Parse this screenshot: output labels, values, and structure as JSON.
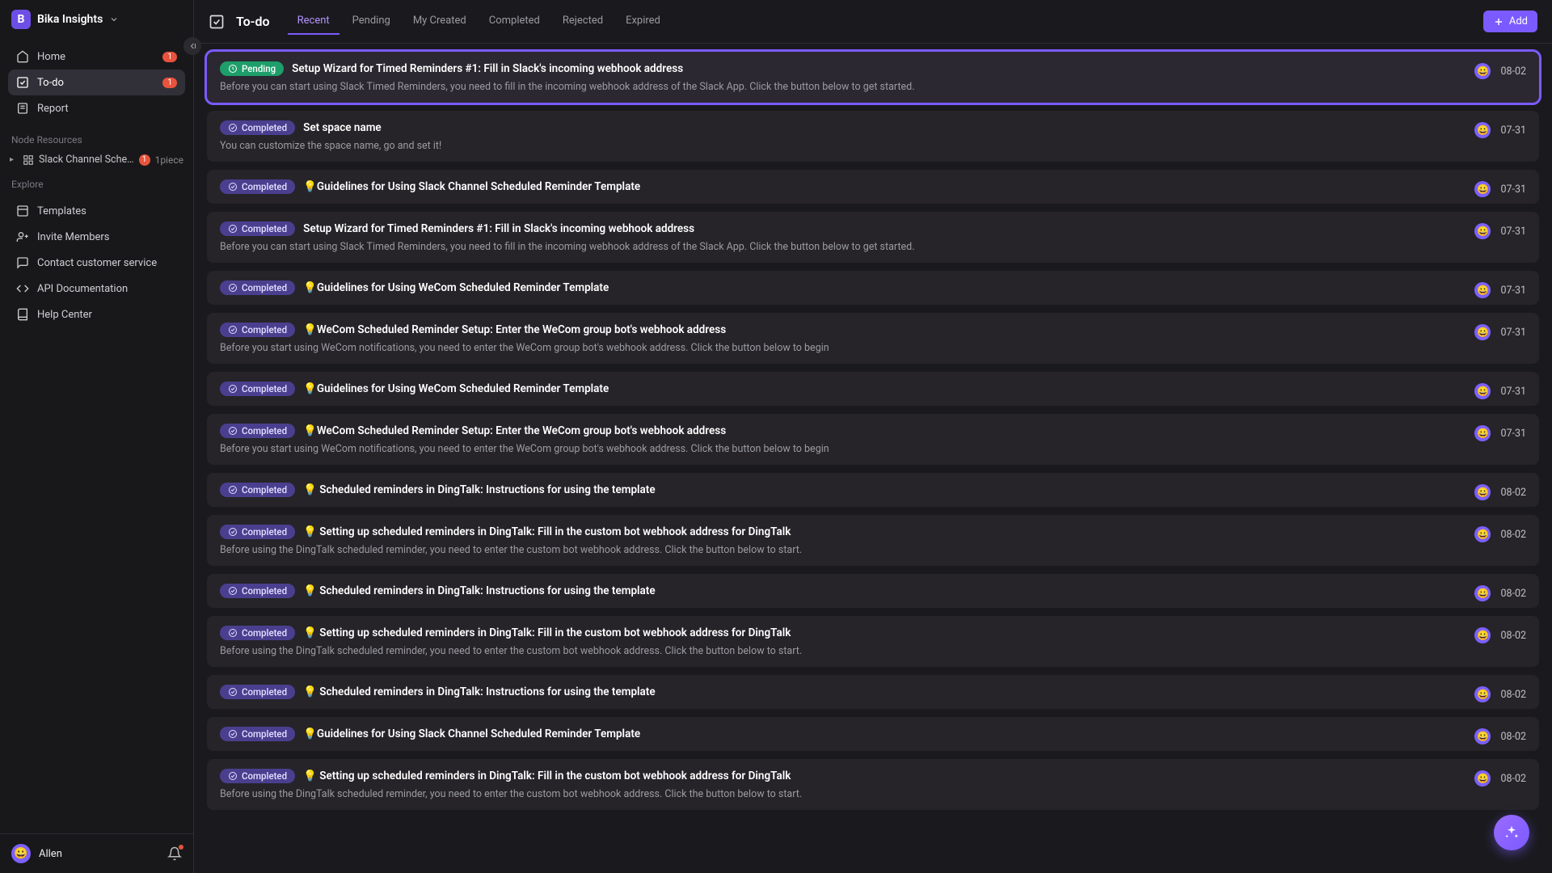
{
  "workspace": {
    "initial": "B",
    "name": "Bika Insights"
  },
  "nav": {
    "home": {
      "label": "Home",
      "badge": "1"
    },
    "todo": {
      "label": "To-do",
      "badge": "1"
    },
    "report": {
      "label": "Report"
    }
  },
  "nodeResourcesLabel": "Node Resources",
  "resource": {
    "name": "Slack Channel Schedul…",
    "badge": "1",
    "count": "1piece"
  },
  "exploreLabel": "Explore",
  "explore": {
    "templates": "Templates",
    "invite": "Invite Members",
    "contact": "Contact customer service",
    "api": "API Documentation",
    "help": "Help Center"
  },
  "user": {
    "name": "Allen",
    "emoji": "😀"
  },
  "header": {
    "title": "To-do",
    "addLabel": "Add"
  },
  "tabs": [
    {
      "label": "Recent",
      "active": true
    },
    {
      "label": "Pending"
    },
    {
      "label": "My Created"
    },
    {
      "label": "Completed"
    },
    {
      "label": "Rejected"
    },
    {
      "label": "Expired"
    }
  ],
  "statusLabels": {
    "pending": "Pending",
    "completed": "Completed"
  },
  "cards": [
    {
      "status": "pending",
      "title": "Setup Wizard for Timed Reminders #1: Fill in Slack's incoming webhook address",
      "desc": "Before you can start using Slack Timed Reminders, you need to fill in the incoming webhook address of the Slack App. Click the button below to get started.",
      "date": "08-02",
      "highlight": true
    },
    {
      "status": "completed",
      "title": "Set space name",
      "desc": "You can customize the space name, go and set it!",
      "date": "07-31"
    },
    {
      "status": "completed",
      "title": "💡Guidelines for Using Slack Channel Scheduled Reminder Template",
      "desc": "",
      "date": "07-31"
    },
    {
      "status": "completed",
      "title": "Setup Wizard for Timed Reminders #1: Fill in Slack's incoming webhook address",
      "desc": "Before you can start using Slack Timed Reminders, you need to fill in the incoming webhook address of the Slack App. Click the button below to get started.",
      "date": "07-31"
    },
    {
      "status": "completed",
      "title": "💡Guidelines for Using WeCom Scheduled Reminder Template",
      "desc": "",
      "date": "07-31"
    },
    {
      "status": "completed",
      "title": "💡WeCom Scheduled Reminder Setup: Enter the WeCom group bot's webhook address",
      "desc": "Before you start using WeCom notifications, you need to enter the WeCom group bot's webhook address. Click the button below to begin",
      "date": "07-31"
    },
    {
      "status": "completed",
      "title": "💡Guidelines for Using WeCom Scheduled Reminder Template",
      "desc": "",
      "date": "07-31"
    },
    {
      "status": "completed",
      "title": "💡WeCom Scheduled Reminder Setup: Enter the WeCom group bot's webhook address",
      "desc": "Before you start using WeCom notifications, you need to enter the WeCom group bot's webhook address. Click the button below to begin",
      "date": "07-31"
    },
    {
      "status": "completed",
      "title": "💡 Scheduled reminders in DingTalk: Instructions for using the template",
      "desc": "",
      "date": "08-02"
    },
    {
      "status": "completed",
      "title": "💡 Setting up scheduled reminders in DingTalk: Fill in the custom bot webhook address for DingTalk",
      "desc": "Before using the DingTalk scheduled reminder, you need to enter the custom bot webhook address. Click the button below to start.",
      "date": "08-02"
    },
    {
      "status": "completed",
      "title": "💡 Scheduled reminders in DingTalk: Instructions for using the template",
      "desc": "",
      "date": "08-02"
    },
    {
      "status": "completed",
      "title": "💡 Setting up scheduled reminders in DingTalk: Fill in the custom bot webhook address for DingTalk",
      "desc": "Before using the DingTalk scheduled reminder, you need to enter the custom bot webhook address. Click the button below to start.",
      "date": "08-02"
    },
    {
      "status": "completed",
      "title": "💡 Scheduled reminders in DingTalk: Instructions for using the template",
      "desc": "",
      "date": "08-02"
    },
    {
      "status": "completed",
      "title": "💡Guidelines for Using Slack Channel Scheduled Reminder Template",
      "desc": "",
      "date": "08-02"
    },
    {
      "status": "completed",
      "title": "💡 Setting up scheduled reminders in DingTalk: Fill in the custom bot webhook address for DingTalk",
      "desc": "Before using the DingTalk scheduled reminder, you need to enter the custom bot webhook address. Click the button below to start.",
      "date": "08-02"
    }
  ]
}
